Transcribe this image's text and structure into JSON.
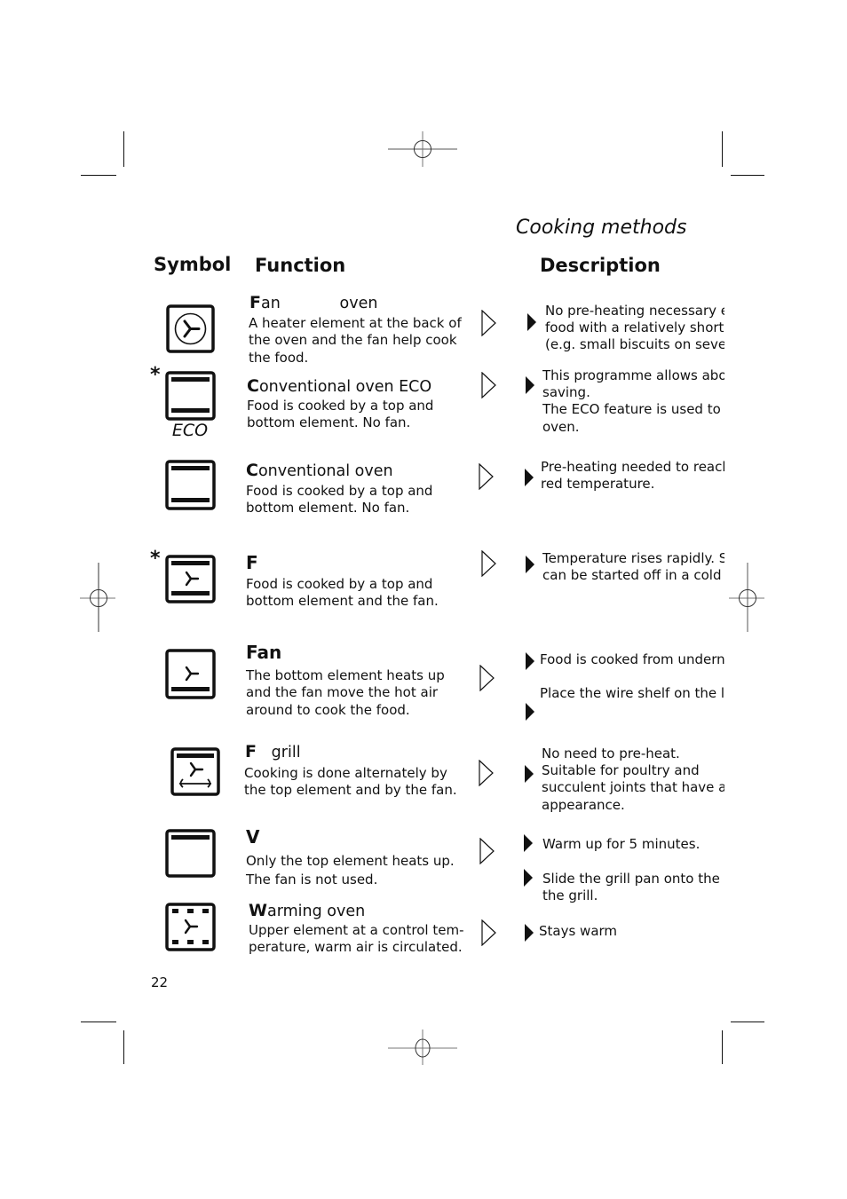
{
  "page": {
    "section_title": "Cooking methods",
    "page_number": "22"
  },
  "headers": {
    "symbol": "Symbol",
    "function": "Function",
    "description": "Description"
  },
  "rows": [
    {
      "icon": "fan-oven-icon",
      "asterisk": "",
      "name_initial": "F",
      "name_rest": "an            oven",
      "function_text": "A heater element at the back of the oven and the fan help cook the food.",
      "description_lines": [
        "No pre-heating necessary except for",
        "food with a relatively short cooking time",
        "(e.g. small biscuits on several levels)"
      ]
    },
    {
      "icon": "conventional-oven-eco-icon",
      "icon_label": "ECO",
      "asterisk": "*",
      "name_initial": "C",
      "name_rest": "onventional oven ECO",
      "function_text": "Food is cooked by a top and bottom element. No fan.",
      "description_lines": [
        "This programme allows about energy",
        "saving.",
        "The ECO feature is used to keep warm the",
        "oven."
      ]
    },
    {
      "icon": "conventional-oven-icon",
      "asterisk": "",
      "name_initial": "C",
      "name_rest": "onventional oven",
      "function_text": "Food is cooked by a top and bottom element. No fan.",
      "description_lines": [
        "Pre-heating needed to reach the desi-",
        "red temperature."
      ]
    },
    {
      "icon": "fan-with-top-bottom-icon",
      "asterisk": "*",
      "name_initial": "F",
      "name_rest": "",
      "function_text": "Food is cooked by a top and bottom element and the fan.",
      "description_lines": [
        "Temperature rises rapidly. Some dishes",
        "can be started off in a cold oven."
      ]
    },
    {
      "icon": "fan-bottom-icon",
      "asterisk": "",
      "name_initial": "Fan",
      "name_rest": "",
      "function_text": "The bottom element heats up and the fan move the hot air around to cook the food.",
      "description_lines": [
        "Food is cooked from underneath.",
        "",
        "Place the wire shelf on the lowest level."
      ]
    },
    {
      "icon": "fan-grill-icon",
      "asterisk": "",
      "name_initial": "F",
      "name_rest": "   grill",
      "function_text": "Cooking is done alternately by the top element and by the fan.",
      "description_lines": [
        "No need to pre-heat.",
        "Suitable for poultry and",
        "succulent joints that have a golden",
        "appearance."
      ]
    },
    {
      "icon": "top-element-grill-icon",
      "asterisk": "",
      "name_initial": "V",
      "name_rest": "",
      "function_text_lines": [
        "Only the top element heats up.",
        "The fan is not used."
      ],
      "description_lines": [
        "Warm up for 5 minutes.",
        "Slide the grill pan onto the middle of",
        "the grill."
      ]
    },
    {
      "icon": "warming-oven-icon",
      "asterisk": "",
      "name_initial": "W",
      "name_rest": "arming oven",
      "function_text": "Upper element at a control tem-perature, warm air is circulated.",
      "description_lines": [
        "Stays warm"
      ]
    }
  ]
}
